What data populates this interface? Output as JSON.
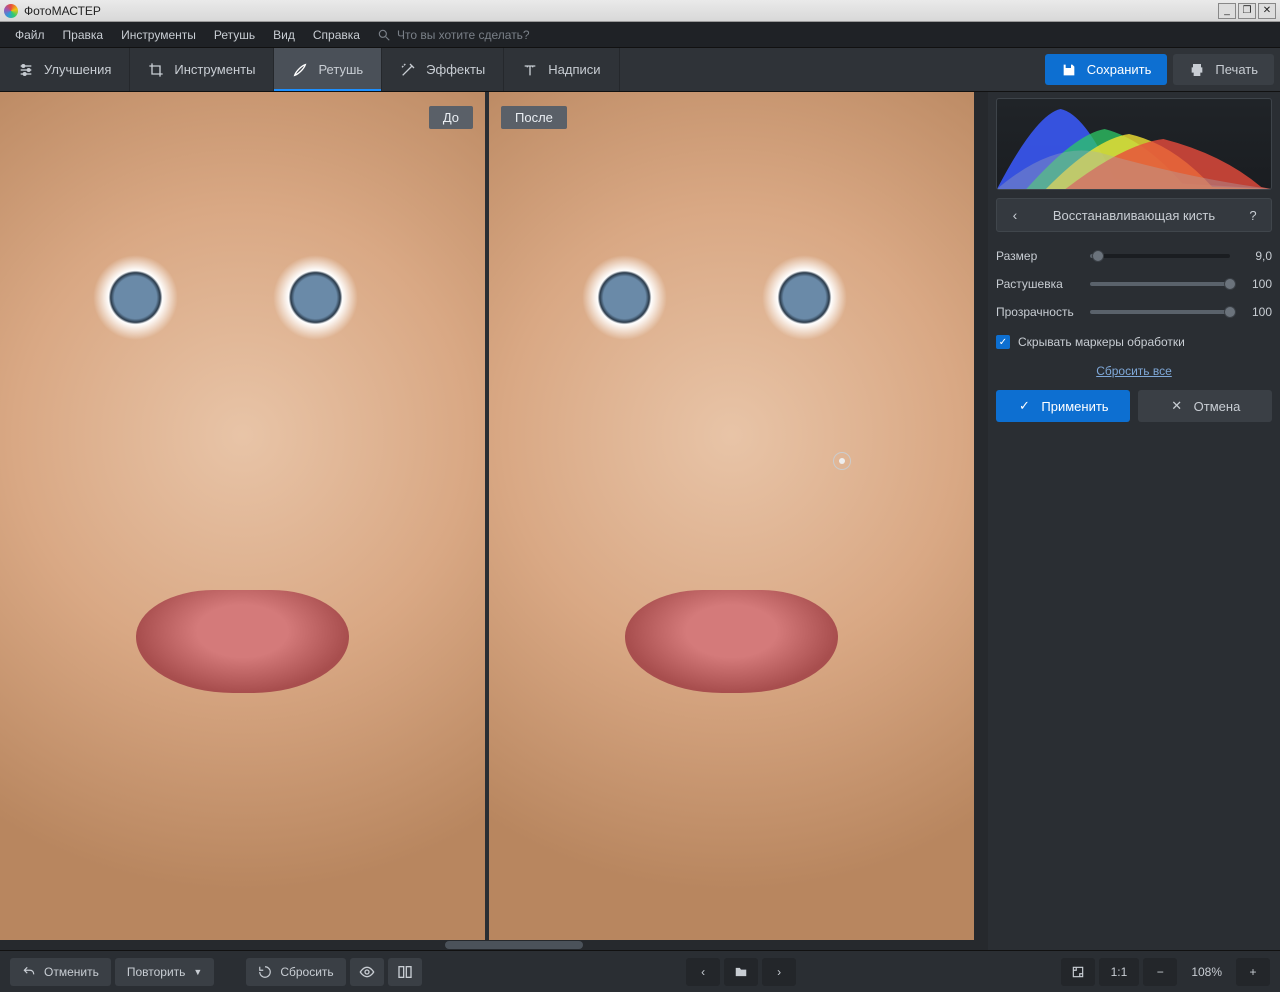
{
  "app": {
    "title": "ФотоМАСТЕР"
  },
  "menubar": {
    "items": [
      "Файл",
      "Правка",
      "Инструменты",
      "Ретушь",
      "Вид",
      "Справка"
    ],
    "search_placeholder": "Что вы хотите сделать?"
  },
  "tabs": [
    {
      "label": "Улучшения"
    },
    {
      "label": "Инструменты"
    },
    {
      "label": "Ретушь"
    },
    {
      "label": "Эффекты"
    },
    {
      "label": "Надписи"
    }
  ],
  "active_tab_index": 2,
  "actions": {
    "save": "Сохранить",
    "print": "Печать"
  },
  "compare": {
    "before": "До",
    "after": "После"
  },
  "panel": {
    "title": "Восстанавливающая кисть",
    "sliders": [
      {
        "label": "Размер",
        "value": "9,0",
        "percent": 6
      },
      {
        "label": "Растушевка",
        "value": "100",
        "percent": 100
      },
      {
        "label": "Прозрачность",
        "value": "100",
        "percent": 100
      }
    ],
    "checkbox_label": "Скрывать маркеры обработки",
    "checkbox_checked": true,
    "reset_label": "Сбросить все",
    "apply": "Применить",
    "cancel": "Отмена"
  },
  "bottom": {
    "undo": "Отменить",
    "redo": "Повторить",
    "reset": "Сбросить",
    "zoom_text": "108%",
    "ratio": "1:1"
  }
}
